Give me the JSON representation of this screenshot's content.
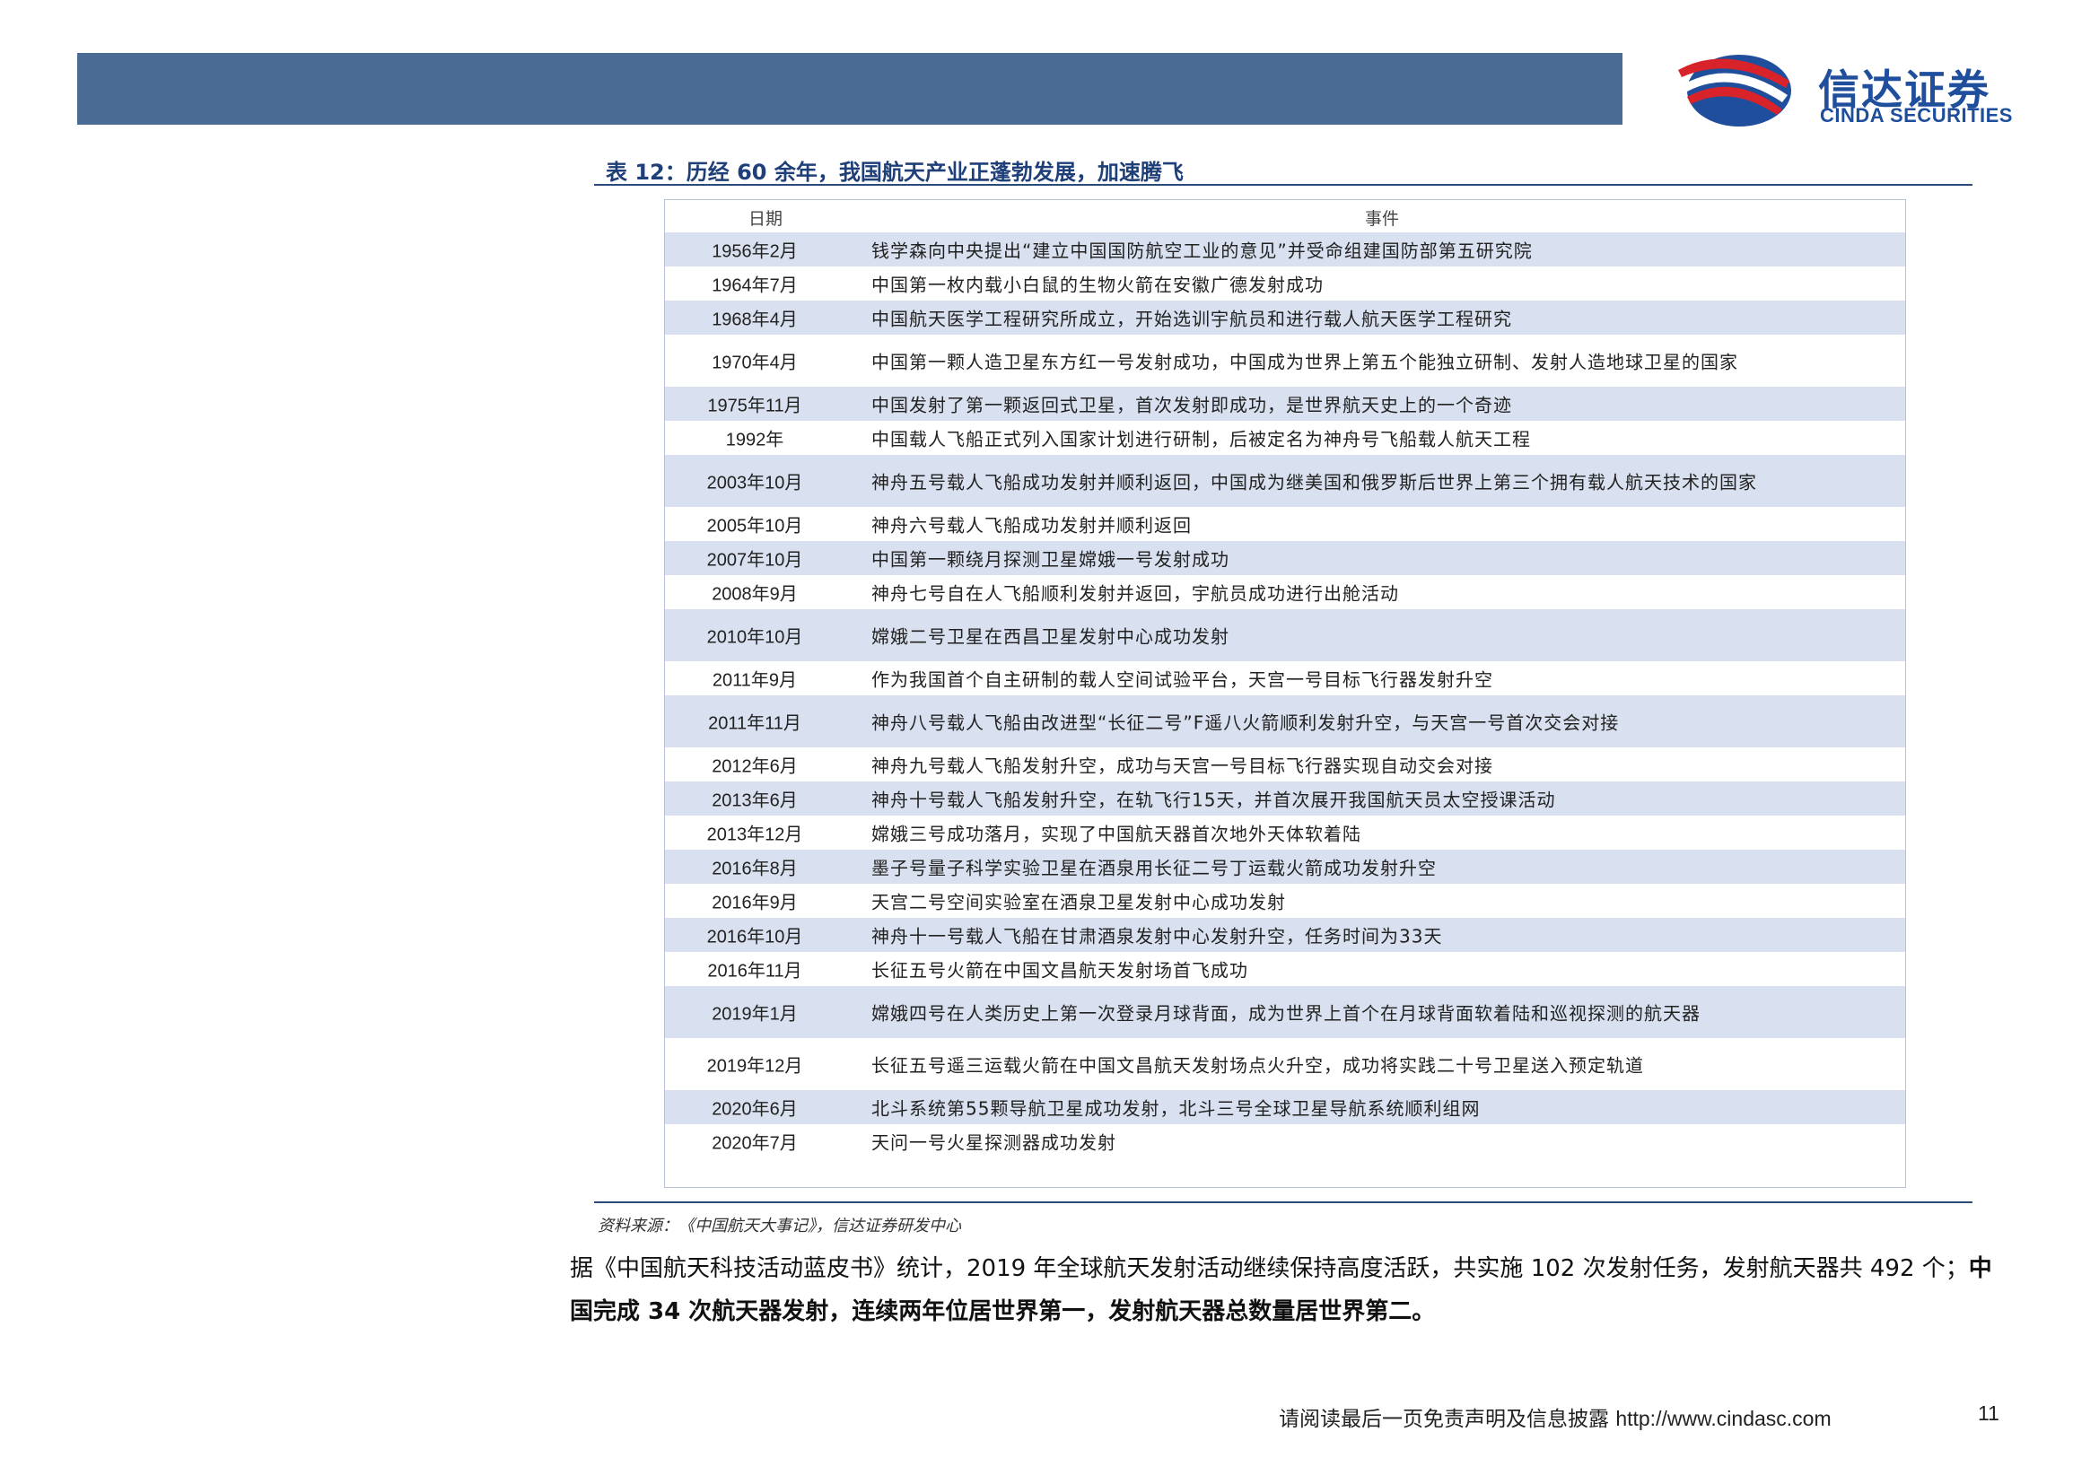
{
  "header": {
    "logo_cn": "信达证券",
    "logo_en": "CINDA SECURITIES"
  },
  "table": {
    "title": "表 12：历经 60 余年，我国航天产业正蓬勃发展，加速腾飞",
    "col_date": "日期",
    "col_event": "事件",
    "rows": [
      {
        "date": "1956年2月",
        "event": "钱学森向中央提出“建立中国国防航空工业的意见”并受命组建国防部第五研究院"
      },
      {
        "date": "1964年7月",
        "event": "中国第一枚内载小白鼠的生物火箭在安徽广德发射成功"
      },
      {
        "date": "1968年4月",
        "event": "中国航天医学工程研究所成立，开始选训宇航员和进行载人航天医学工程研究"
      },
      {
        "date": "1970年4月",
        "event": "中国第一颗人造卫星东方红一号发射成功，中国成为世界上第五个能独立研制、发射人造地球卫星的国家"
      },
      {
        "date": "1975年11月",
        "event": "中国发射了第一颗返回式卫星，首次发射即成功，是世界航天史上的一个奇迹"
      },
      {
        "date": "1992年",
        "event": "中国载人飞船正式列入国家计划进行研制，后被定名为神舟号飞船载人航天工程"
      },
      {
        "date": "2003年10月",
        "event": "神舟五号载人飞船成功发射并顺利返回，中国成为继美国和俄罗斯后世界上第三个拥有载人航天技术的国家"
      },
      {
        "date": "2005年10月",
        "event": "神舟六号载人飞船成功发射并顺利返回"
      },
      {
        "date": "2007年10月",
        "event": "中国第一颗绕月探测卫星嫦娥一号发射成功"
      },
      {
        "date": "2008年9月",
        "event": "神舟七号自在人飞船顺利发射并返回，宇航员成功进行出舱活动"
      },
      {
        "date": "2010年10月",
        "event": "嫦娥二号卫星在西昌卫星发射中心成功发射"
      },
      {
        "date": "2011年9月",
        "event": "作为我国首个自主研制的载人空间试验平台，天宫一号目标飞行器发射升空"
      },
      {
        "date": "2011年11月",
        "event": "神舟八号载人飞船由改进型“长征二号”F遥八火箭顺利发射升空，与天宫一号首次交会对接"
      },
      {
        "date": "2012年6月",
        "event": "神舟九号载人飞船发射升空，成功与天宫一号目标飞行器实现自动交会对接"
      },
      {
        "date": "2013年6月",
        "event": "神舟十号载人飞船发射升空，在轨飞行15天，并首次展开我国航天员太空授课活动"
      },
      {
        "date": "2013年12月",
        "event": "嫦娥三号成功落月，实现了中国航天器首次地外天体软着陆"
      },
      {
        "date": "2016年8月",
        "event": "墨子号量子科学实验卫星在酒泉用长征二号丁运载火箭成功发射升空"
      },
      {
        "date": "2016年9月",
        "event": "天宫二号空间实验室在酒泉卫星发射中心成功发射"
      },
      {
        "date": "2016年10月",
        "event": "神舟十一号载人飞船在甘肃酒泉发射中心发射升空，任务时间为33天"
      },
      {
        "date": "2016年11月",
        "event": "长征五号火箭在中国文昌航天发射场首飞成功"
      },
      {
        "date": "2019年1月",
        "event": "嫦娥四号在人类历史上第一次登录月球背面，成为世界上首个在月球背面软着陆和巡视探测的航天器"
      },
      {
        "date": "2019年12月",
        "event": "长征五号遥三运载火箭在中国文昌航天发射场点火升空，成功将实践二十号卫星送入预定轨道"
      },
      {
        "date": "2020年6月",
        "event": "北斗系统第55颗导航卫星成功发射，北斗三号全球卫星导航系统顺利组网"
      },
      {
        "date": "2020年7月",
        "event": "天问一号火星探测器成功发射"
      }
    ]
  },
  "source": "资料来源：《中国航天大事记》，信达证券研发中心",
  "paragraph": {
    "normal": "据《中国航天科技活动蓝皮书》统计，2019 年全球航天发射活动继续保持高度活跃，共实施 102 次发射任务，发射航天器共 492 个；",
    "bold": "中国完成 34 次航天器发射，连续两年位居世界第一，发射航天器总数量居世界第二。"
  },
  "footer": {
    "disclaimer": "请阅读最后一页免责声明及信息披露",
    "url": "http://www.cindasc.com",
    "page": "11"
  }
}
